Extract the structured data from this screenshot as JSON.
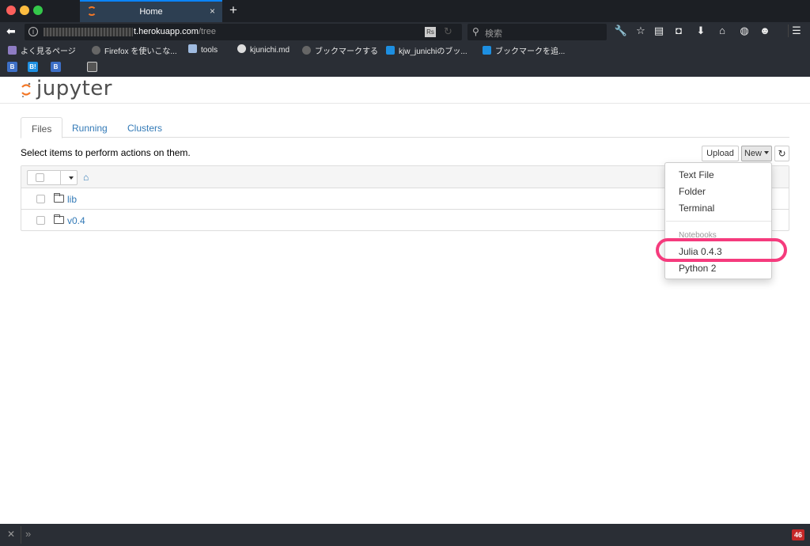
{
  "browser": {
    "tab_title": "Home",
    "tab_close": "×",
    "new_tab": "+",
    "url_host": "t.herokuapp.com",
    "url_path": "/tree",
    "search_placeholder": "検索",
    "bookmarks": [
      {
        "label": "よく見るページ",
        "icon": "frequent-pages-icon",
        "color": "#8e7cc3"
      },
      {
        "label": "Firefox を使いこな...",
        "icon": "globe-icon",
        "color": "#666"
      },
      {
        "label": "tools",
        "icon": "folder-icon",
        "color": "#9fbbe0"
      },
      {
        "label": "kjunichi.md",
        "icon": "github-icon",
        "color": "#ddd"
      },
      {
        "label": "ブックマークする",
        "icon": "globe-icon",
        "color": "#666"
      },
      {
        "label": "kjw_junichiのブッ...",
        "icon": "hatena-bookmark-icon",
        "color": "#1d8fe1"
      },
      {
        "label": "ブックマークを追...",
        "icon": "hatena-bookmark-icon",
        "color": "#1d8fe1"
      }
    ],
    "bookmark_icons_row2": [
      {
        "label": "B",
        "icon": "bookmarklet-b-icon",
        "color": "#3d6fc6"
      },
      {
        "label": "B!",
        "icon": "hatena-bookmark-icon",
        "color": "#1d8fe1"
      },
      {
        "label": "B",
        "icon": "bookmarklet-b-icon",
        "color": "#3d6fc6"
      },
      {
        "label": "",
        "icon": "console-icon",
        "color": "#555"
      }
    ],
    "status_badge": "46"
  },
  "jupyter": {
    "logo_text": "jupyter",
    "tabs": [
      "Files",
      "Running",
      "Clusters"
    ],
    "hint": "Select items to perform actions on them.",
    "upload_label": "Upload",
    "new_label": "New",
    "files": [
      {
        "name": "lib",
        "type": "folder"
      },
      {
        "name": "v0.4",
        "type": "folder"
      }
    ],
    "new_menu": {
      "items": [
        "Text File",
        "Folder",
        "Terminal"
      ],
      "section_header": "Notebooks",
      "notebooks": [
        "Julia 0.4.3",
        "Python 2"
      ]
    },
    "highlight_color": "#f53b7d"
  }
}
